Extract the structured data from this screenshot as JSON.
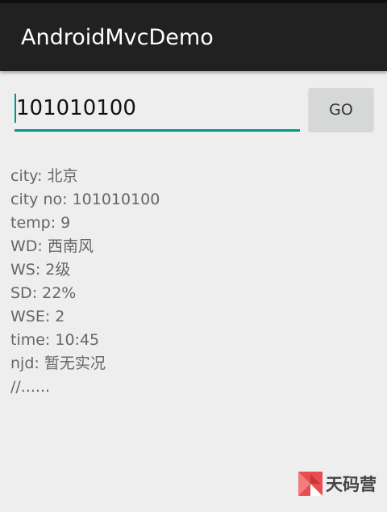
{
  "app": {
    "title": "AndroidMvcDemo"
  },
  "search": {
    "value": "101010100",
    "button_label": "GO"
  },
  "weather_lines": [
    "city: 北京",
    "city no: 101010100",
    "temp: 9",
    "WD: 西南风",
    "WS: 2级",
    "SD: 22%",
    "WSE: 2",
    "time: 10:45",
    "njd: 暂无实况",
    "//......"
  ],
  "watermark": {
    "text": "天码营",
    "logo_icon": "tianmaying-logo-icon"
  },
  "colors": {
    "accent": "#009688",
    "action_bar": "#212121",
    "background": "#eeeeee"
  }
}
